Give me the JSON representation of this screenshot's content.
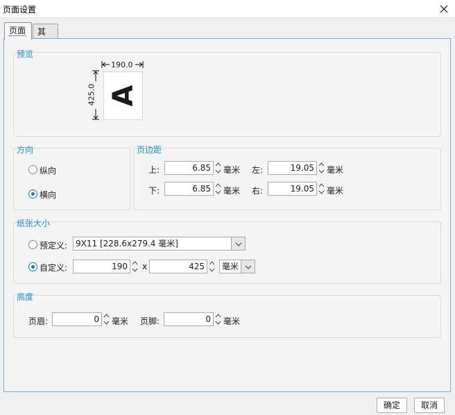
{
  "window": {
    "title": "页面设置",
    "close_icon": "close-icon"
  },
  "tabs": [
    {
      "label": "页面"
    },
    {
      "label": "其他"
    }
  ],
  "preview": {
    "section_title": "预览",
    "width_label": "190.0",
    "height_label": "425.0",
    "letter": "A"
  },
  "orientation": {
    "section_title": "方向",
    "portrait_label": "纵向",
    "landscape_label": "横向",
    "selected": "landscape"
  },
  "margins": {
    "section_title": "页边距",
    "top_label": "上:",
    "top_value": "6.85",
    "bottom_label": "下:",
    "bottom_value": "6.85",
    "left_label": "左:",
    "left_value": "19.05",
    "right_label": "右:",
    "right_value": "19.05",
    "unit": "毫米"
  },
  "paper": {
    "section_title": "纸张大小",
    "preset_label": "预定义:",
    "preset_value": "9X11 [228.6x279.4 毫米]",
    "custom_label": "自定义:",
    "custom_width": "190",
    "separator": "x",
    "custom_height": "425",
    "unit_value": "毫米",
    "selected": "custom"
  },
  "height": {
    "section_title": "高度",
    "header_label": "页眉:",
    "header_value": "0",
    "footer_label": "页脚:",
    "footer_value": "0",
    "unit": "毫米"
  },
  "buttons": {
    "ok": "确定",
    "cancel": "取消"
  }
}
